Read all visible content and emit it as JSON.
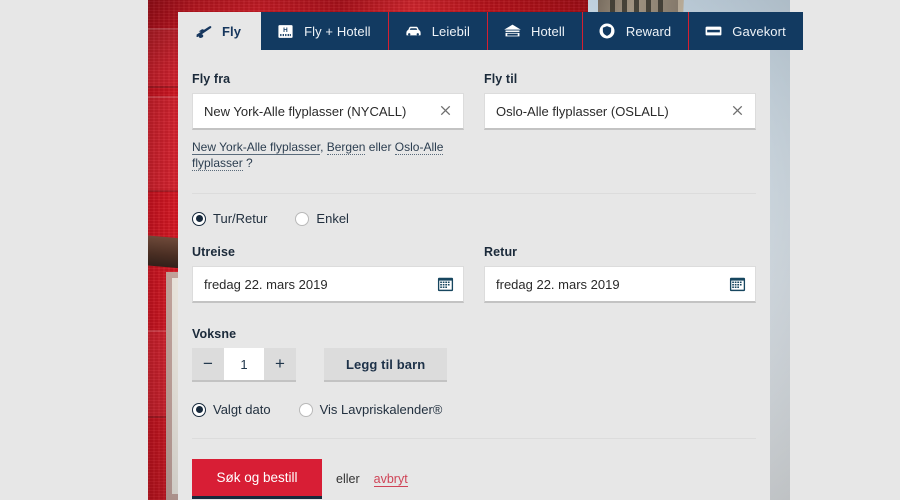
{
  "tabs": [
    {
      "label": "Fly",
      "icon": "airplane-icon",
      "active": true
    },
    {
      "label": "Fly + Hotell",
      "icon": "hotel-sign-icon",
      "active": false
    },
    {
      "label": "Leiebil",
      "icon": "car-icon",
      "active": false
    },
    {
      "label": "Hotell",
      "icon": "building-icon",
      "active": false
    },
    {
      "label": "Reward",
      "icon": "reward-icon",
      "active": false
    },
    {
      "label": "Gavekort",
      "icon": "giftcard-icon",
      "active": false
    }
  ],
  "form": {
    "origin": {
      "label": "Fly fra",
      "value": "New York-Alle flyplasser (NYCALL)",
      "placeholder": "Fly fra",
      "clear_icon": "close-icon"
    },
    "destination": {
      "label": "Fly til",
      "value": "Oslo-Alle flyplasser (OSLALL)",
      "placeholder": "Fly til",
      "clear_icon": "close-icon"
    },
    "hint": {
      "part1": "New York-Alle flyplasser",
      "sep1": ", ",
      "part2": "Bergen",
      "sep2": " eller ",
      "part3": "Oslo-Alle flyplasser",
      "suffix": " ?"
    },
    "trip_type": {
      "options": [
        "Tur/Retur",
        "Enkel"
      ],
      "selected": "Tur/Retur"
    },
    "depart": {
      "label": "Utreise",
      "value": "fredag 22. mars 2019",
      "icon": "calendar-icon"
    },
    "return": {
      "label": "Retur",
      "value": "fredag 22. mars 2019",
      "icon": "calendar-icon"
    },
    "adults": {
      "label": "Voksne",
      "count": "1",
      "decrement": "−",
      "increment": "+",
      "add_child_label": "Legg til barn"
    },
    "date_mode": {
      "options": [
        "Valgt dato",
        "Vis Lavpriskalender®"
      ],
      "selected": "Valgt dato"
    },
    "submit_label": "Søk og bestill",
    "or_text": "eller",
    "cancel_label": "avbryt"
  },
  "colors": {
    "tab_bg": "#123a61",
    "tab_divider": "#d51f30",
    "panel_bg": "#e7e7e7",
    "submit_red": "#d81e35",
    "submit_underline": "#17293c",
    "cancel_link": "#cf4457",
    "text_dark": "#17375e"
  }
}
